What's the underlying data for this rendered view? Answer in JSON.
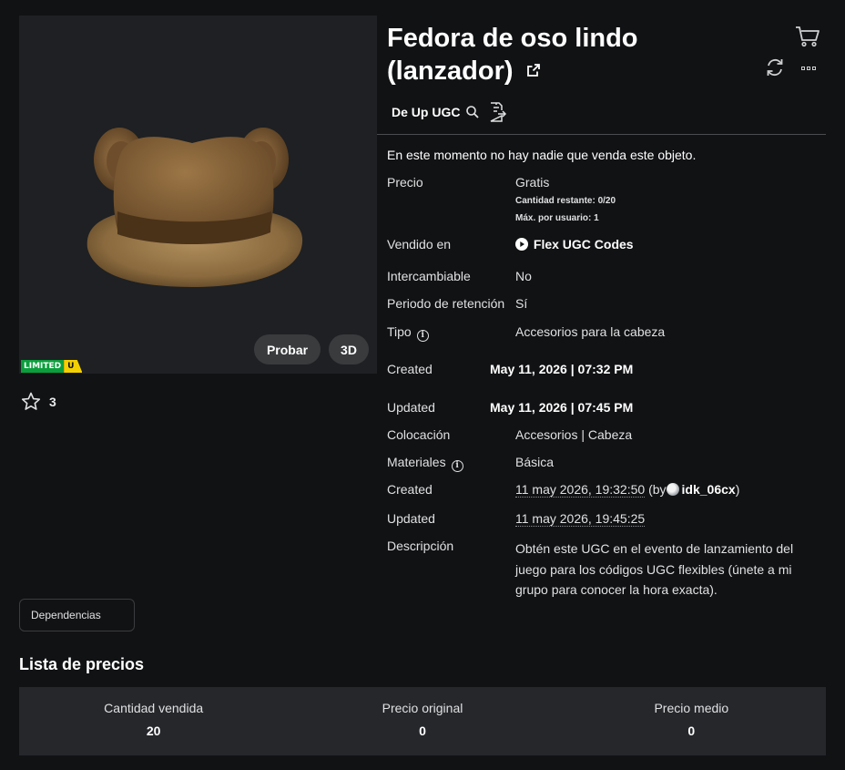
{
  "item": {
    "title": "Fedora de oso lindo (lanzador)",
    "creator_label": "De Up UGC",
    "badge_limited": "LIMITED",
    "badge_u": "U",
    "try_on_label": "Probar",
    "view3d_label": "3D",
    "favorites": "3"
  },
  "details": {
    "notice": "En este momento no hay nadie que venda este objeto.",
    "price_label": "Precio",
    "price_value": "Gratis",
    "quantity_left": "Cantidad restante: 0/20",
    "max_per_user": "Máx. por usuario: 1",
    "sold_in_label": "Vendido en",
    "sold_in_value": "Flex UGC Codes",
    "tradable_label": "Intercambiable",
    "tradable_value": "No",
    "hold_label": "Periodo de retención",
    "hold_value": "Sí",
    "type_label": "Tipo",
    "type_value": "Accesorios para la cabeza",
    "created_label": "Created",
    "created_value": "May 11, 2026 | 07:32 PM",
    "updated_label": "Updated",
    "updated_value": "May 11, 2026 | 07:45 PM",
    "placement_label": "Colocación",
    "placement_value": "Accesorios | Cabeza",
    "materials_label": "Materiales",
    "materials_value": "Básica",
    "created2_label": "Created",
    "created2_value": "11 may 2026, 19:32:50",
    "created2_by": "(by",
    "created2_user": "idk_06cx",
    "created2_close": ")",
    "updated2_label": "Updated",
    "updated2_value": "11 may 2026, 19:45:25",
    "description_label": "Descripción",
    "description_value": "Obtén este UGC en el evento de lanzamiento del juego para los códigos UGC flexibles (únete a mi grupo para conocer la hora exacta)."
  },
  "dependencies_label": "Dependencias",
  "price_list": {
    "heading": "Lista de precios",
    "stats": [
      {
        "label": "Cantidad vendida",
        "value": "20"
      },
      {
        "label": "Precio original",
        "value": "0"
      },
      {
        "label": "Precio medio",
        "value": "0"
      }
    ]
  },
  "icons": {
    "cart": "cart-icon",
    "refresh": "refresh-icon",
    "more": "more-options-icon",
    "external": "external-link-icon",
    "search": "search-icon",
    "report": "report-icon",
    "star": "star-icon",
    "play": "play-icon",
    "info": "info-icon"
  }
}
